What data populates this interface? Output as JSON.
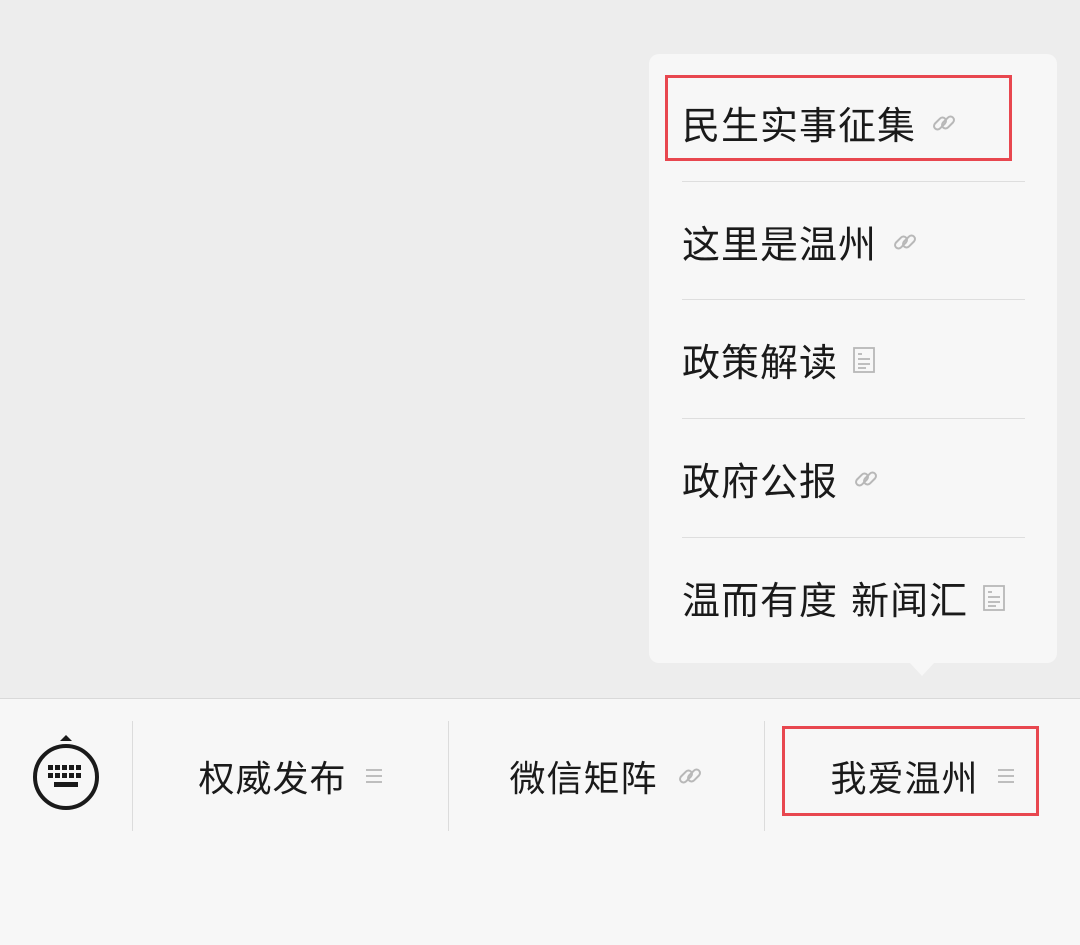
{
  "submenu": {
    "items": [
      {
        "label": "民生实事征集",
        "icon": "link-icon"
      },
      {
        "label": "这里是温州",
        "icon": "link-icon"
      },
      {
        "label": "政策解读",
        "icon": "article-icon"
      },
      {
        "label": "政府公报",
        "icon": "link-icon"
      },
      {
        "label": "温而有度 新闻汇",
        "icon": "article-icon"
      }
    ]
  },
  "menu_bar": {
    "keyboard_icon": "keyboard-icon",
    "buttons": [
      {
        "label": "权威发布",
        "icon": "submenu-icon"
      },
      {
        "label": "微信矩阵",
        "icon": "link-icon"
      },
      {
        "label": "我爱温州",
        "icon": "submenu-icon"
      }
    ]
  },
  "colors": {
    "highlight": "#e8474f",
    "background": "#ededed",
    "panel": "#f7f7f7",
    "icon_gray": "#b8b8b8"
  }
}
